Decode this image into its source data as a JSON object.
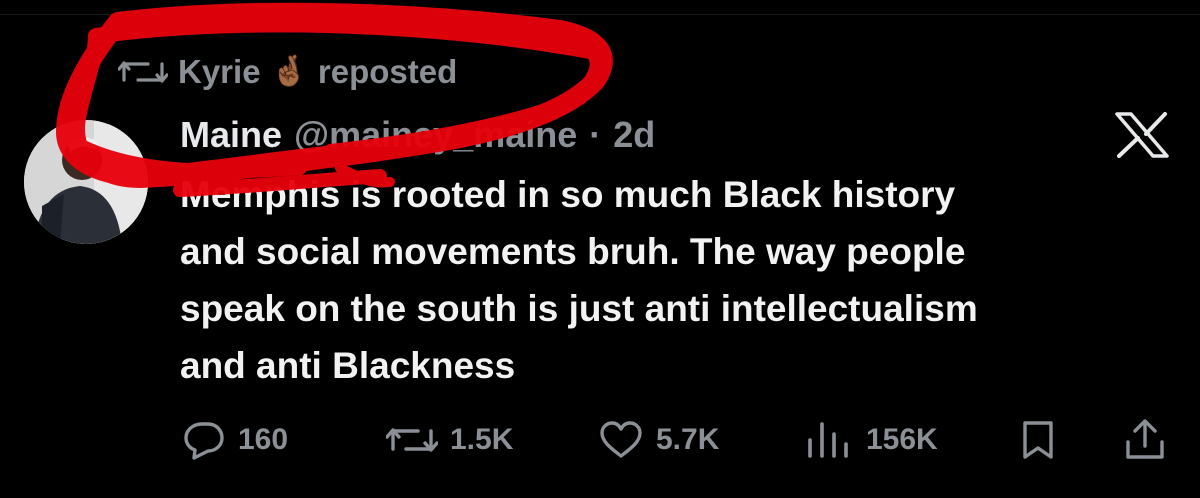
{
  "repost": {
    "user": "Kyrie",
    "emoji": "🤞🏾",
    "label": "reposted",
    "icon": "repost-icon"
  },
  "author": {
    "display_name": "Maine",
    "handle": "@mainey_maine",
    "separator": "·",
    "time": "2d",
    "avatar_icon": "avatar"
  },
  "brand": {
    "logo": "x-logo",
    "color": "#e7e9ea"
  },
  "tweet": {
    "lines": [
      "Memphis is rooted in so much Black history",
      "and social movements bruh. The way people",
      "speak on the south is just anti intellectualism",
      "and anti Blackness"
    ]
  },
  "actions": {
    "reply": {
      "icon": "reply-icon",
      "count": "160"
    },
    "retweet": {
      "icon": "repost-icon",
      "count": "1.5K"
    },
    "like": {
      "icon": "heart-icon",
      "count": "5.7K"
    },
    "views": {
      "icon": "views-icon",
      "count": "156K"
    },
    "bookmark": {
      "icon": "bookmark-icon"
    },
    "share": {
      "icon": "share-icon"
    }
  },
  "colors": {
    "background": "#000000",
    "text": "#e7e9ea",
    "muted": "#8b9096",
    "annotation": "#e8000b"
  }
}
